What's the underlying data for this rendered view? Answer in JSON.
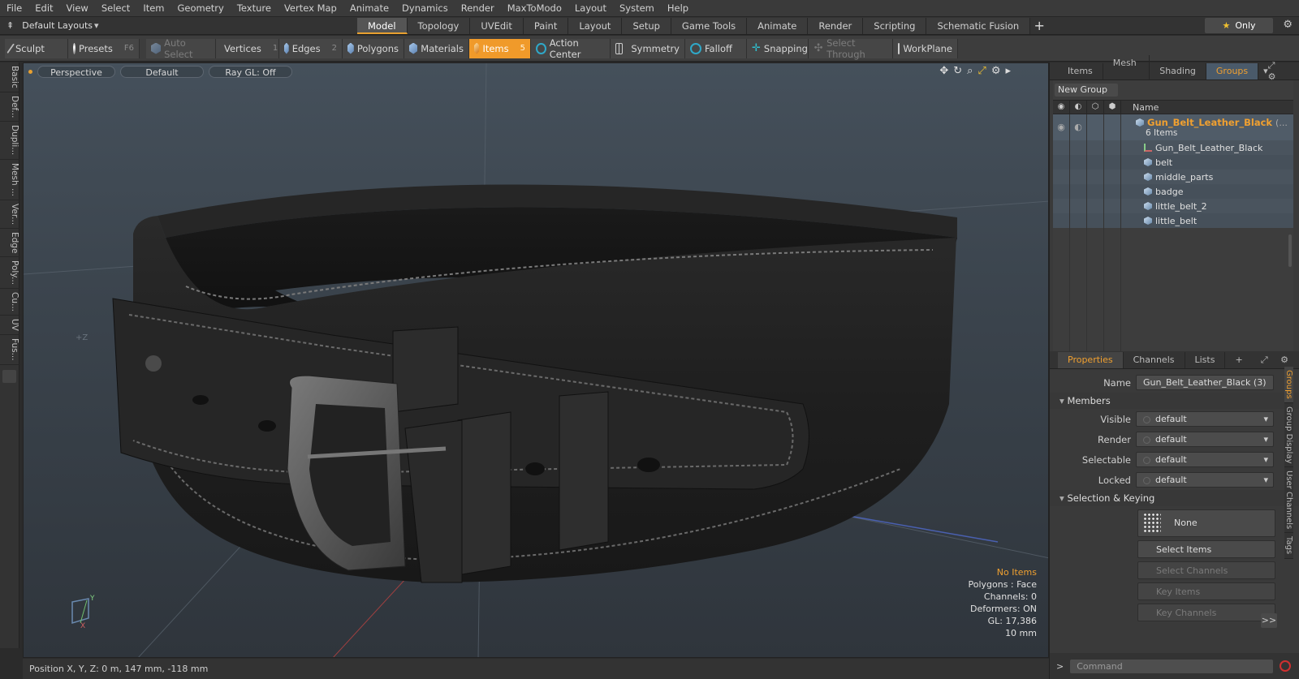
{
  "menu": [
    "File",
    "Edit",
    "View",
    "Select",
    "Item",
    "Geometry",
    "Texture",
    "Vertex Map",
    "Animate",
    "Dynamics",
    "Render",
    "MaxToModo",
    "Layout",
    "System",
    "Help"
  ],
  "layoutbar": {
    "layout_name": "Default Layouts",
    "tabs": [
      "Model",
      "Topology",
      "UVEdit",
      "Paint",
      "Layout",
      "Setup",
      "Game Tools",
      "Animate",
      "Render",
      "Scripting",
      "Schematic Fusion"
    ],
    "active_tab": "Model",
    "plus": "+",
    "only_label": "Only"
  },
  "toolbar": {
    "sculpt": "Sculpt",
    "presets": "Presets",
    "presets_key": "F6",
    "auto_select": "Auto Select",
    "vertices": "Vertices",
    "vertices_key": "1",
    "edges": "Edges",
    "edges_key": "2",
    "polygons": "Polygons",
    "materials": "Materials",
    "items": "Items",
    "items_key": "5",
    "action_center": "Action Center",
    "symmetry": "Symmetry",
    "falloff": "Falloff",
    "snapping": "Snapping",
    "select_through": "Select Through",
    "workplane": "WorkPlane"
  },
  "left_tabs": [
    "Basic",
    "Def...",
    "Dupli...",
    "Mesh ...",
    "Ver...",
    "Edge",
    "Poly...",
    "Cu...",
    "UV",
    "Fus..."
  ],
  "viewport": {
    "view_mode": "Perspective",
    "shading": "Default",
    "raygl": "Ray GL: Off",
    "axis_label": "+Z",
    "info": {
      "no_items": "No Items",
      "polygons": "Polygons : Face",
      "channels": "Channels: 0",
      "deformers": "Deformers: ON",
      "gl": "GL: 17,386",
      "scale": "10 mm"
    },
    "gizmo": {
      "y": "Y",
      "x": "X"
    }
  },
  "status": {
    "position": "Position X, Y, Z:   0 m, 147 mm, -118 mm"
  },
  "groups_panel": {
    "tabs": [
      "Items",
      "Mesh ...",
      "Shading",
      "Groups"
    ],
    "active_tab": "Groups",
    "new_group": "New Group",
    "name_header": "Name",
    "group": {
      "name": "Gun_Belt_Leather_Black",
      "suffix": "(...",
      "count": "6 Items"
    },
    "children": [
      {
        "name": "Gun_Belt_Leather_Black",
        "type": "locator"
      },
      {
        "name": "belt",
        "type": "mesh"
      },
      {
        "name": "middle_parts",
        "type": "mesh"
      },
      {
        "name": "badge",
        "type": "mesh"
      },
      {
        "name": "little_belt_2",
        "type": "mesh"
      },
      {
        "name": "little_belt",
        "type": "mesh"
      }
    ]
  },
  "properties_panel": {
    "tabs": [
      "Properties",
      "Channels",
      "Lists",
      "+"
    ],
    "active_tab": "Properties",
    "name_label": "Name",
    "name_value": "Gun_Belt_Leather_Black (3)",
    "members_section": "Members",
    "fields": [
      {
        "label": "Visible",
        "value": "default"
      },
      {
        "label": "Render",
        "value": "default"
      },
      {
        "label": "Selectable",
        "value": "default"
      },
      {
        "label": "Locked",
        "value": "default"
      }
    ],
    "selection_section": "Selection & Keying",
    "none_label": "None",
    "buttons": [
      {
        "label": "Select Items",
        "enabled": true
      },
      {
        "label": "Select Channels",
        "enabled": false
      },
      {
        "label": "Key Items",
        "enabled": false
      },
      {
        "label": "Key Channels",
        "enabled": false
      }
    ],
    "more": ">>",
    "side_tabs": [
      "Groups",
      "Group Display",
      "User Channels",
      "Tags"
    ]
  },
  "command": {
    "placeholder": "Command",
    "chevron": ">"
  },
  "colors": {
    "accent": "#f09a2a",
    "viewport_top": "#45505b",
    "viewport_bottom": "#2f353c",
    "group_row": "#505c68"
  }
}
